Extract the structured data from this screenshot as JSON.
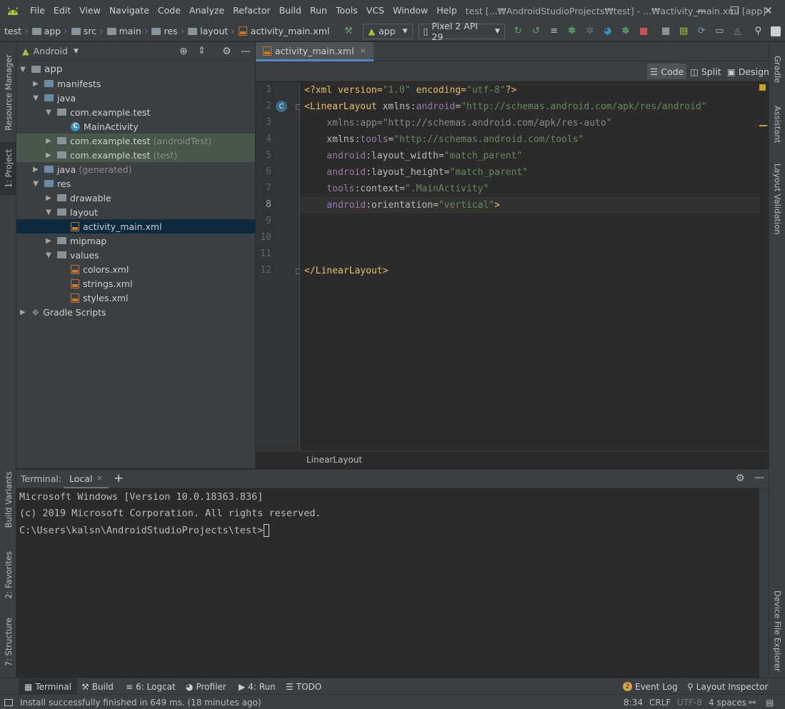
{
  "menu": {
    "items": [
      "File",
      "Edit",
      "View",
      "Navigate",
      "Code",
      "Analyze",
      "Refactor",
      "Build",
      "Run",
      "Tools",
      "VCS",
      "Window",
      "Help"
    ],
    "window_title": "test [...₩AndroidStudioProjects₩test] - ...₩activity_main.xml [app]"
  },
  "navbar": {
    "crumbs": [
      "test",
      "app",
      "src",
      "main",
      "res",
      "layout",
      "activity_main.xml"
    ],
    "run_config": "app",
    "device": "Pixel 2 API 29"
  },
  "left_strip": {
    "resource_manager": "Resource Manager",
    "project": "1: Project",
    "build_variants": "Build Variants",
    "favorites": "2: Favorites",
    "structure": "7: Structure"
  },
  "right_strip": {
    "gradle": "Gradle",
    "assistant": "Assistant",
    "layout_validation": "Layout Validation",
    "device_file_explorer": "Device File Explorer"
  },
  "project": {
    "view_mode": "Android",
    "tree": {
      "app": "app",
      "manifests": "manifests",
      "java": "java",
      "pkg_main": "com.example.test",
      "main_activity": "MainActivity",
      "pkg_android_test": "com.example.test",
      "android_test_tag": "(androidTest)",
      "pkg_test": "com.example.test",
      "test_tag": "(test)",
      "java_generated": "java",
      "generated_tag": "(generated)",
      "res": "res",
      "drawable": "drawable",
      "layout": "layout",
      "activity_main": "activity_main.xml",
      "mipmap": "mipmap",
      "values": "values",
      "colors": "colors.xml",
      "strings": "strings.xml",
      "styles": "styles.xml",
      "gradle_scripts": "Gradle Scripts"
    }
  },
  "editor": {
    "tab_label": "activity_main.xml",
    "view_modes": [
      "Code",
      "Split",
      "Design"
    ],
    "line_numbers": [
      "1",
      "2",
      "3",
      "4",
      "5",
      "6",
      "7",
      "8",
      "9",
      "10",
      "11",
      "12"
    ],
    "lines": {
      "l1": {
        "a": "<?xml version=",
        "b": "\"1.0\"",
        "c": " encoding=",
        "d": "\"utf-8\"",
        "e": "?>"
      },
      "l2": {
        "a": "<LinearLayout ",
        "b": "xmlns:",
        "c": "android",
        "d": "=",
        "e": "\"http://schemas.android.com/apk/res/android\""
      },
      "l3": {
        "a": "    xmlns:app=\"http://schemas.android.com/apk/res-auto\""
      },
      "l4": {
        "a": "    xmlns:",
        "b": "tools",
        "c": "=",
        "d": "\"http://schemas.android.com/tools\""
      },
      "l5": {
        "a": "    android",
        "b": ":layout_width=",
        "c": "\"match_parent\""
      },
      "l6": {
        "a": "    android",
        "b": ":layout_height=",
        "c": "\"match_parent\""
      },
      "l7": {
        "a": "    tools",
        "b": ":context=",
        "c": "\".MainActivity\""
      },
      "l8": {
        "a": "    android",
        "b": ":orientation=",
        "c": "\"vertical\"",
        "d": ">"
      },
      "l12": {
        "a": "</LinearLayout>"
      }
    },
    "breadcrumb": "LinearLayout"
  },
  "terminal": {
    "title": "Terminal:",
    "tab": "Local",
    "lines": [
      "Microsoft Windows [Version 10.0.18363.836]",
      "(c) 2019 Microsoft Corporation. All rights reserved.",
      "C:\\Users\\kalsn\\AndroidStudioProjects\\test>"
    ]
  },
  "toolwindows": {
    "terminal": "Terminal",
    "build": "Build",
    "logcat": "6: Logcat",
    "profiler": "Profiler",
    "run": "4: Run",
    "todo": "TODO",
    "event_log_count": "2",
    "event_log": "Event Log",
    "layout_inspector": "Layout Inspector"
  },
  "status": {
    "message": "Install successfully finished in 649 ms. (18 minutes ago)",
    "position": "8:34",
    "line_sep": "CRLF",
    "encoding": "UTF-8",
    "indent": "4 spaces"
  },
  "colors": {
    "accent": "#4a88c7",
    "android_green": "#a4c639",
    "run_green": "#59a869",
    "stop_red": "#c75450"
  }
}
